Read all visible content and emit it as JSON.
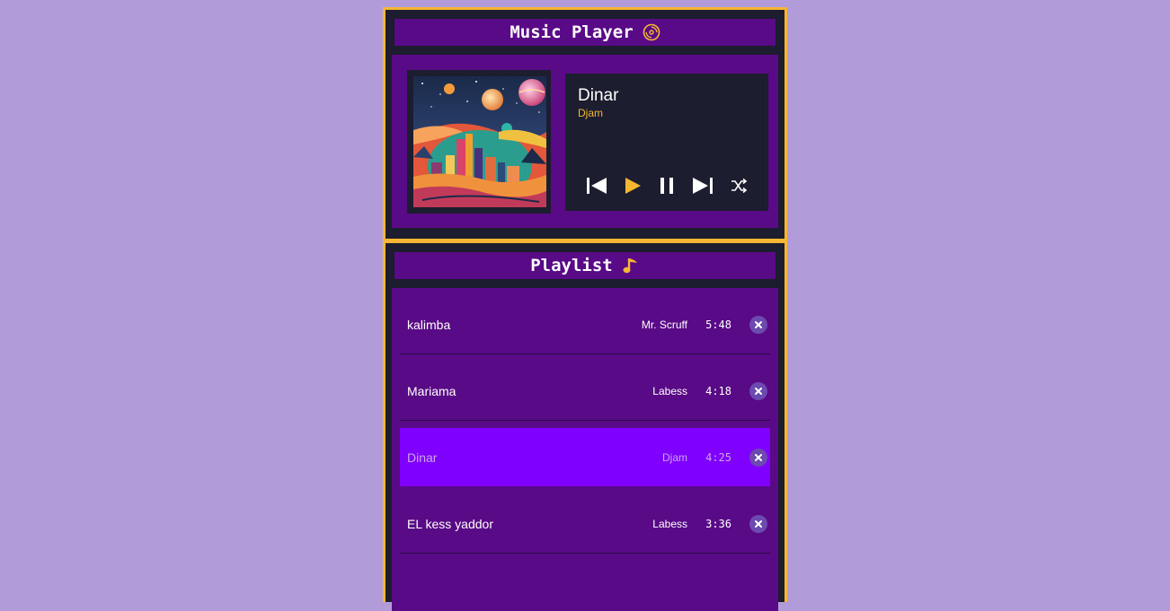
{
  "player": {
    "title": "Music Player",
    "title_icon": "vinyl-disc-icon",
    "now_playing": {
      "title": "Dinar",
      "artist": "Djam"
    },
    "controls": [
      "previous",
      "play",
      "pause",
      "next",
      "shuffle"
    ]
  },
  "playlist": {
    "title": "Playlist",
    "title_icon": "music-note-icon",
    "tracks": [
      {
        "name": "kalimba",
        "artist": "Mr. Scruff",
        "duration": "5:48",
        "active": false
      },
      {
        "name": "Mariama",
        "artist": "Labess",
        "duration": "4:18",
        "active": false
      },
      {
        "name": "Dinar",
        "artist": "Djam",
        "duration": "4:25",
        "active": true
      },
      {
        "name": "EL kess yaddor",
        "artist": "Labess",
        "duration": "3:36",
        "active": false
      }
    ]
  },
  "colors": {
    "background": "#b19cd9",
    "panel": "#1c1d2e",
    "panel_border": "#f5b731",
    "purple": "#590a86",
    "active_row": "#8000ff",
    "accent": "#f5b731"
  }
}
